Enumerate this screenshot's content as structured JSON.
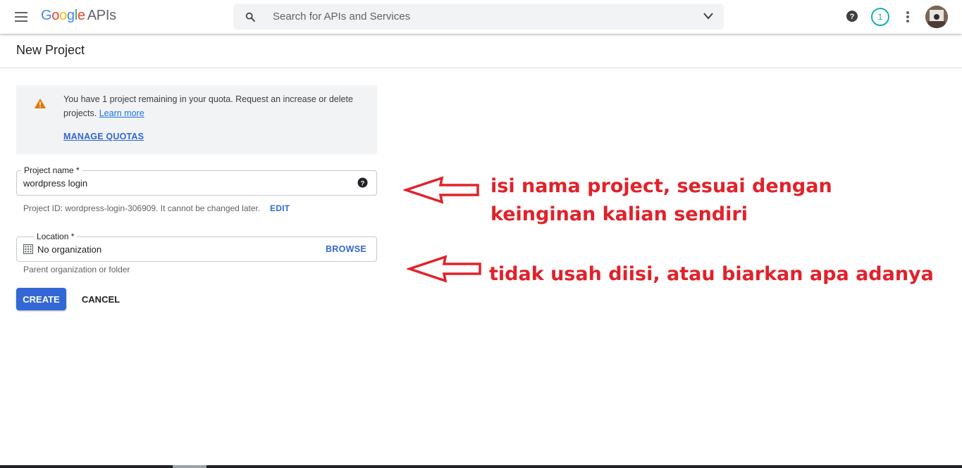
{
  "header": {
    "logo_letters": [
      "G",
      "o",
      "o",
      "g",
      "l",
      "e"
    ],
    "logo_suffix": "APIs",
    "search_placeholder": "Search for APIs and Services",
    "notification_count": "1"
  },
  "page": {
    "title": "New Project"
  },
  "banner": {
    "message": "You have 1 project remaining in your quota. Request an increase or delete projects.",
    "learn_more": "Learn more",
    "manage_quotas": "MANAGE QUOTAS"
  },
  "form": {
    "project_name_label": "Project name *",
    "project_name_value": "wordpress login",
    "project_id_hint": "Project ID: wordpress-login-306909. It cannot be changed later.",
    "edit_label": "EDIT",
    "location_label": "Location *",
    "location_value": "No organization",
    "browse_label": "BROWSE",
    "location_hint": "Parent organization or folder",
    "create_label": "CREATE",
    "cancel_label": "CANCEL"
  },
  "annotations": {
    "note1": "isi nama project, sesuai dengan keinginan kalian sendiri",
    "note2": "tidak usah diisi, atau biarkan apa adanya",
    "color": "#e0222b"
  },
  "icons": {
    "menu": "hamburger-icon",
    "search": "search-icon",
    "chevron": "chevron-down-icon",
    "help": "help-icon",
    "more": "more-vert-icon",
    "warning": "warning-icon",
    "organization": "building-icon"
  }
}
